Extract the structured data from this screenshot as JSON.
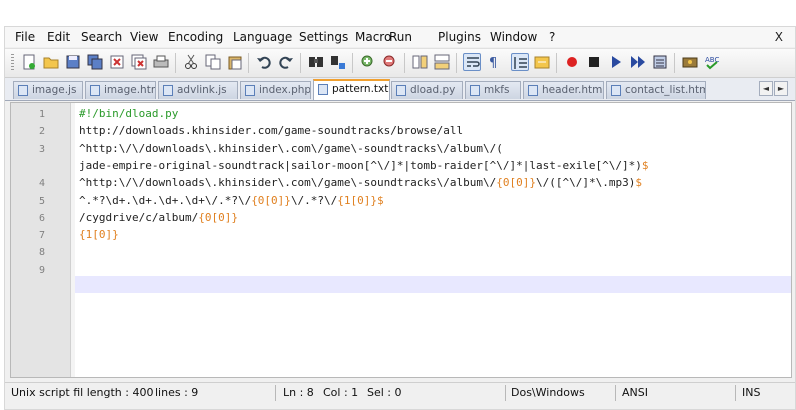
{
  "menu": [
    "File",
    "Edit",
    "Search",
    "View",
    "Encoding",
    "Language",
    "Settings",
    "Macro",
    "Run",
    "Plugins",
    "Window",
    "?"
  ],
  "close_label": "X",
  "toolbar": {
    "buttons": [
      "new-file",
      "open-file",
      "save",
      "save-all",
      "close",
      "close-all",
      "print",
      "cut",
      "copy",
      "paste",
      "undo",
      "redo",
      "find",
      "replace",
      "zoom-in",
      "zoom-out",
      "sync-v",
      "sync-h",
      "word-wrap",
      "show-all-chars",
      "indent-guide",
      "folder-as-workspace",
      "record-macro",
      "stop-record",
      "play-macro",
      "play-multiple",
      "save-macro",
      "run",
      "spell-check"
    ]
  },
  "tabs": [
    {
      "label": "image.js",
      "active": false
    },
    {
      "label": "image.htm",
      "active": false
    },
    {
      "label": "advlink.js",
      "active": false
    },
    {
      "label": "index.php",
      "active": false
    },
    {
      "label": "pattern.txt",
      "active": true
    },
    {
      "label": "dload.py",
      "active": false
    },
    {
      "label": "mkfs",
      "active": false
    },
    {
      "label": "header.html",
      "active": false
    },
    {
      "label": "contact_list.html",
      "active": false
    }
  ],
  "tab_arrows": {
    "left": "◄",
    "right": "►"
  },
  "editor": {
    "line_numbers": [
      "1",
      "2",
      "3",
      "",
      "4",
      "5",
      "6",
      "7",
      "8",
      "9"
    ],
    "lines": [
      {
        "segments": [
          {
            "t": "#!/bin/dload.py",
            "c": "com"
          }
        ]
      },
      {
        "segments": [
          {
            "t": "http://downloads.khinsider.com/game-soundtracks/browse/all",
            "c": ""
          }
        ]
      },
      {
        "segments": [
          {
            "t": "^http:\\/\\/downloads\\.khinsider\\.com\\/game\\-soundtracks\\/album\\/(",
            "c": ""
          }
        ]
      },
      {
        "segments": [
          {
            "t": "jade-empire-original-soundtrack|sailor-moon[^\\/]*|tomb-raider[^\\/]*|last-exile[^\\/]*)",
            "c": ""
          },
          {
            "t": "$",
            "c": "dig"
          }
        ]
      },
      {
        "segments": [
          {
            "t": "^http:\\/\\/downloads\\.khinsider\\.com\\/game\\-soundtracks\\/album\\/",
            "c": ""
          },
          {
            "t": "{0[0]}",
            "c": "dig"
          },
          {
            "t": "\\/([^\\/]*\\.mp3)",
            "c": ""
          },
          {
            "t": "$",
            "c": "dig"
          }
        ]
      },
      {
        "segments": [
          {
            "t": "^.*?\\d+.\\d+.\\d+.\\d+\\/.*?\\/",
            "c": ""
          },
          {
            "t": "{0[0]}",
            "c": "dig"
          },
          {
            "t": "\\/.*?\\/",
            "c": ""
          },
          {
            "t": "{1[0]}",
            "c": "dig"
          },
          {
            "t": "$",
            "c": "dig"
          }
        ]
      },
      {
        "segments": [
          {
            "t": "/cygdrive/c/album/",
            "c": ""
          },
          {
            "t": "{0[0]}",
            "c": "dig"
          }
        ]
      },
      {
        "segments": [
          {
            "t": "{1[0]}",
            "c": "dig"
          }
        ]
      },
      {
        "segments": [
          {
            "t": "",
            "c": ""
          }
        ]
      },
      {
        "segments": [
          {
            "t": "",
            "c": ""
          }
        ]
      }
    ]
  },
  "status": {
    "file_info": "Unix script fil length : 400",
    "lines": "lines : 9",
    "ln": "Ln : 8",
    "col": "Col : 1",
    "sel": "Sel : 0",
    "eol": "Dos\\Windows",
    "encoding": "ANSI",
    "mode": "INS"
  },
  "colors": {
    "active_tab_accent": "#f0a030",
    "current_line": "#e8e8ff",
    "digit": "#e08020",
    "comment": "#2a9a2a"
  }
}
